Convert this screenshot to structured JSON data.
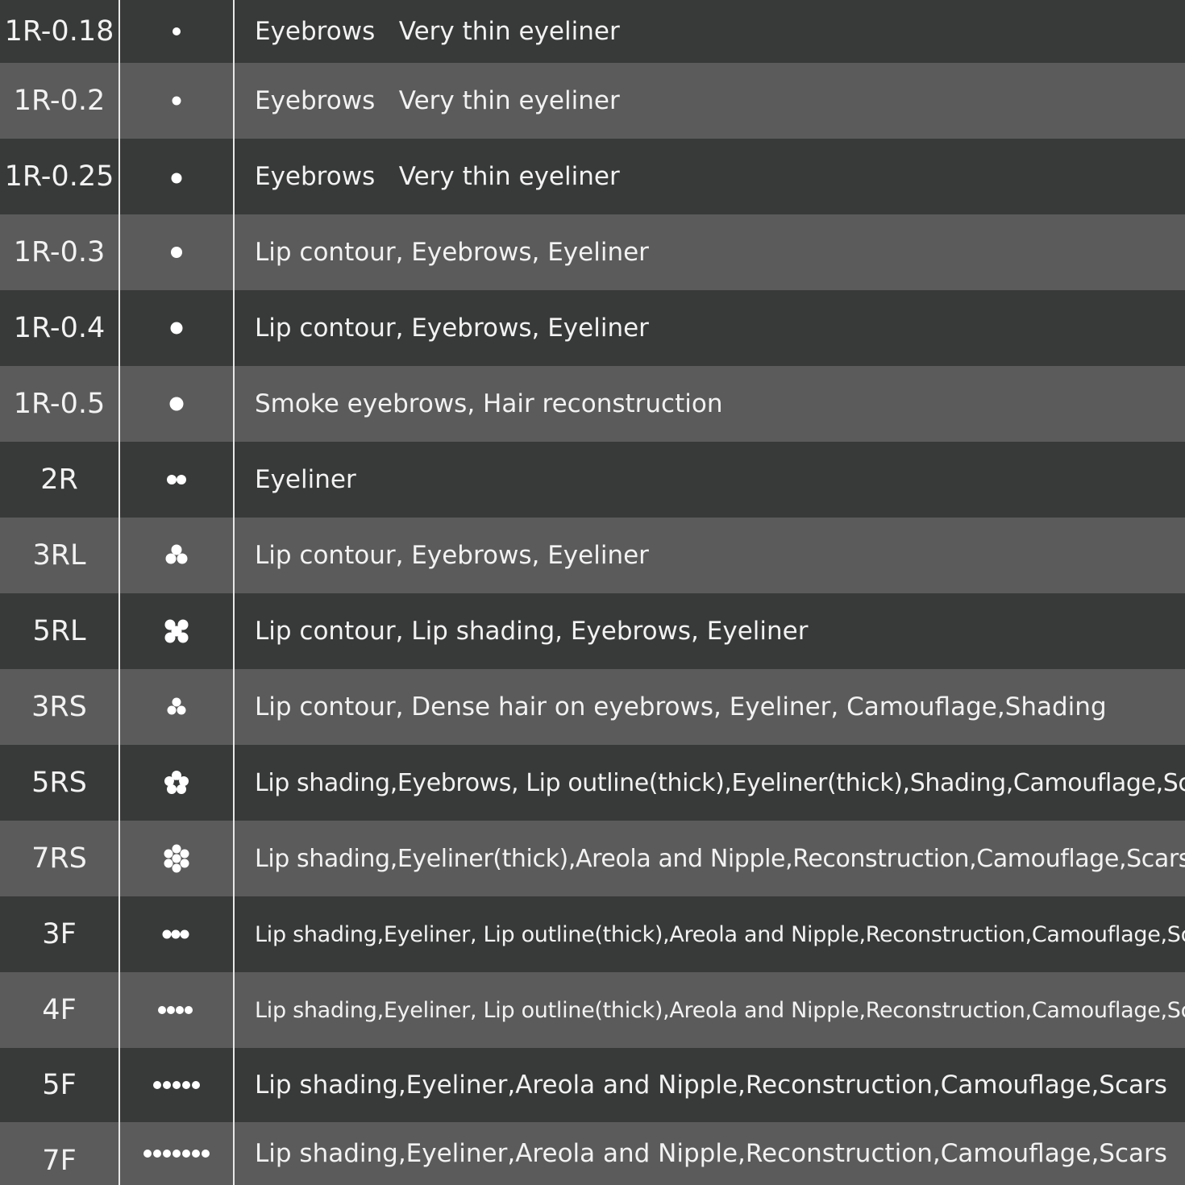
{
  "rows": [
    {
      "code": "1R-0.18",
      "icon": "dot-1-tiny-icon",
      "description": "Eyebrows   Very thin eyeliner"
    },
    {
      "code": "1R-0.2",
      "icon": "dot-1-tiny-icon",
      "description": "Eyebrows   Very thin eyeliner"
    },
    {
      "code": "1R-0.25",
      "icon": "dot-1-small-icon",
      "description": "Eyebrows   Very thin eyeliner"
    },
    {
      "code": "1R-0.3",
      "icon": "dot-1-small-icon",
      "description": "Lip contour, Eyebrows, Eyeliner"
    },
    {
      "code": "1R-0.4",
      "icon": "dot-1-medium-icon",
      "description": "Lip contour, Eyebrows, Eyeliner"
    },
    {
      "code": "1R-0.5",
      "icon": "dot-1-large-icon",
      "description": "Smoke eyebrows, Hair reconstruction"
    },
    {
      "code": "2R",
      "icon": "dots-2-icon",
      "description": "Eyeliner"
    },
    {
      "code": "3RL",
      "icon": "dots-3-cluster-icon",
      "description": "Lip contour, Eyebrows, Eyeliner"
    },
    {
      "code": "5RL",
      "icon": "dots-5-cross-icon",
      "description": "Lip contour, Lip shading, Eyebrows, Eyeliner"
    },
    {
      "code": "3RS",
      "icon": "dots-3-cluster-small-icon",
      "description": "Lip contour, Dense hair on eyebrows, Eyeliner, Camouflage,Shading"
    },
    {
      "code": "5RS",
      "icon": "dots-5-flower-icon",
      "description": "Lip shading,Eyebrows, Lip outline(thick),Eyeliner(thick),Shading,Camouflage,Scars"
    },
    {
      "code": "7RS",
      "icon": "dots-7-flower-icon",
      "description": "Lip shading,Eyeliner(thick),Areola and Nipple,Reconstruction,Camouflage,Scars"
    },
    {
      "code": "3F",
      "icon": "dots-3-row-icon",
      "description": "Lip shading,Eyeliner, Lip outline(thick),Areola and Nipple,Reconstruction,Camouflage,Scars"
    },
    {
      "code": "4F",
      "icon": "dots-4-row-icon",
      "description": "Lip shading,Eyeliner, Lip outline(thick),Areola and Nipple,Reconstruction,Camouflage,Scars"
    },
    {
      "code": "5F",
      "icon": "dots-5-row-icon",
      "description": "Lip shading,Eyeliner,Areola and Nipple,Reconstruction,Camouflage,Scars"
    },
    {
      "code": "7F",
      "icon": "dots-7-row-icon",
      "description": "Lip shading,Eyeliner,Areola and Nipple,Reconstruction,Camouflage,Scars"
    }
  ],
  "colors": {
    "row_dark": "#383939",
    "row_light": "#5b5b5b",
    "divider": "#e8e8e8",
    "text": "#f2f2f2"
  }
}
